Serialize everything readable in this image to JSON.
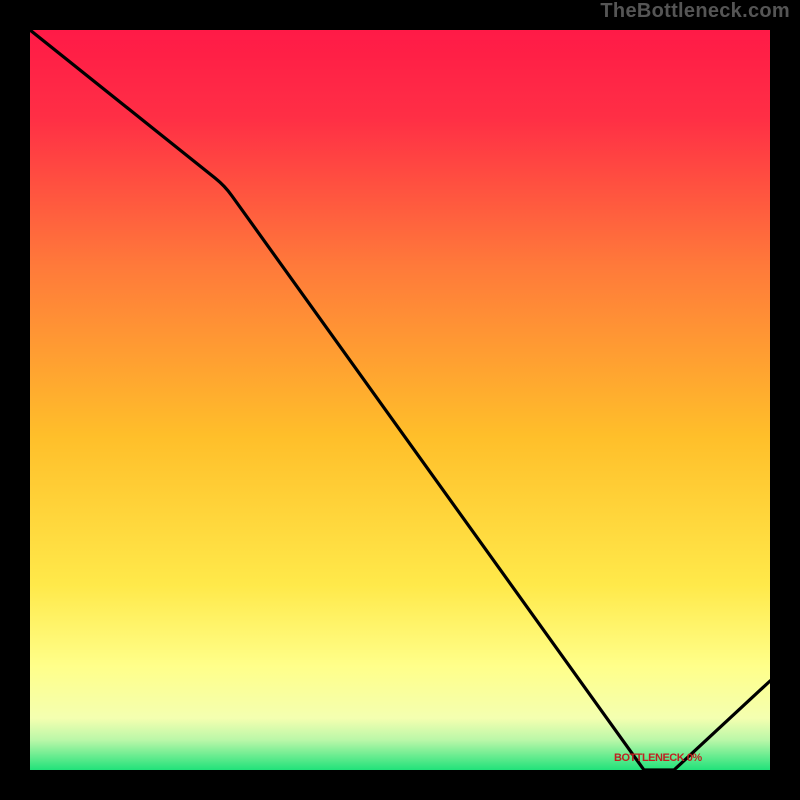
{
  "watermark": "TheBottleneck.com",
  "marker_label": "BOTTLENECK 0%",
  "colors": {
    "frame": "#000000",
    "gradient_top": "#ff1a47",
    "gradient_mid": "#ffbf2a",
    "gradient_low": "#ffff8a",
    "gradient_bottom": "#21e27a",
    "curve": "#000000"
  },
  "chart_data": {
    "type": "line",
    "title": "",
    "xlabel": "",
    "ylabel": "",
    "xlim": [
      0,
      100
    ],
    "ylim": [
      0,
      100
    ],
    "series": [
      {
        "name": "bottleneck-curve",
        "x": [
          0,
          25,
          83,
          87,
          100
        ],
        "y": [
          100,
          80,
          0,
          0,
          12
        ]
      }
    ],
    "annotations": [
      {
        "text": "BOTTLENECK 0%",
        "x": 85,
        "y": 3
      }
    ]
  }
}
